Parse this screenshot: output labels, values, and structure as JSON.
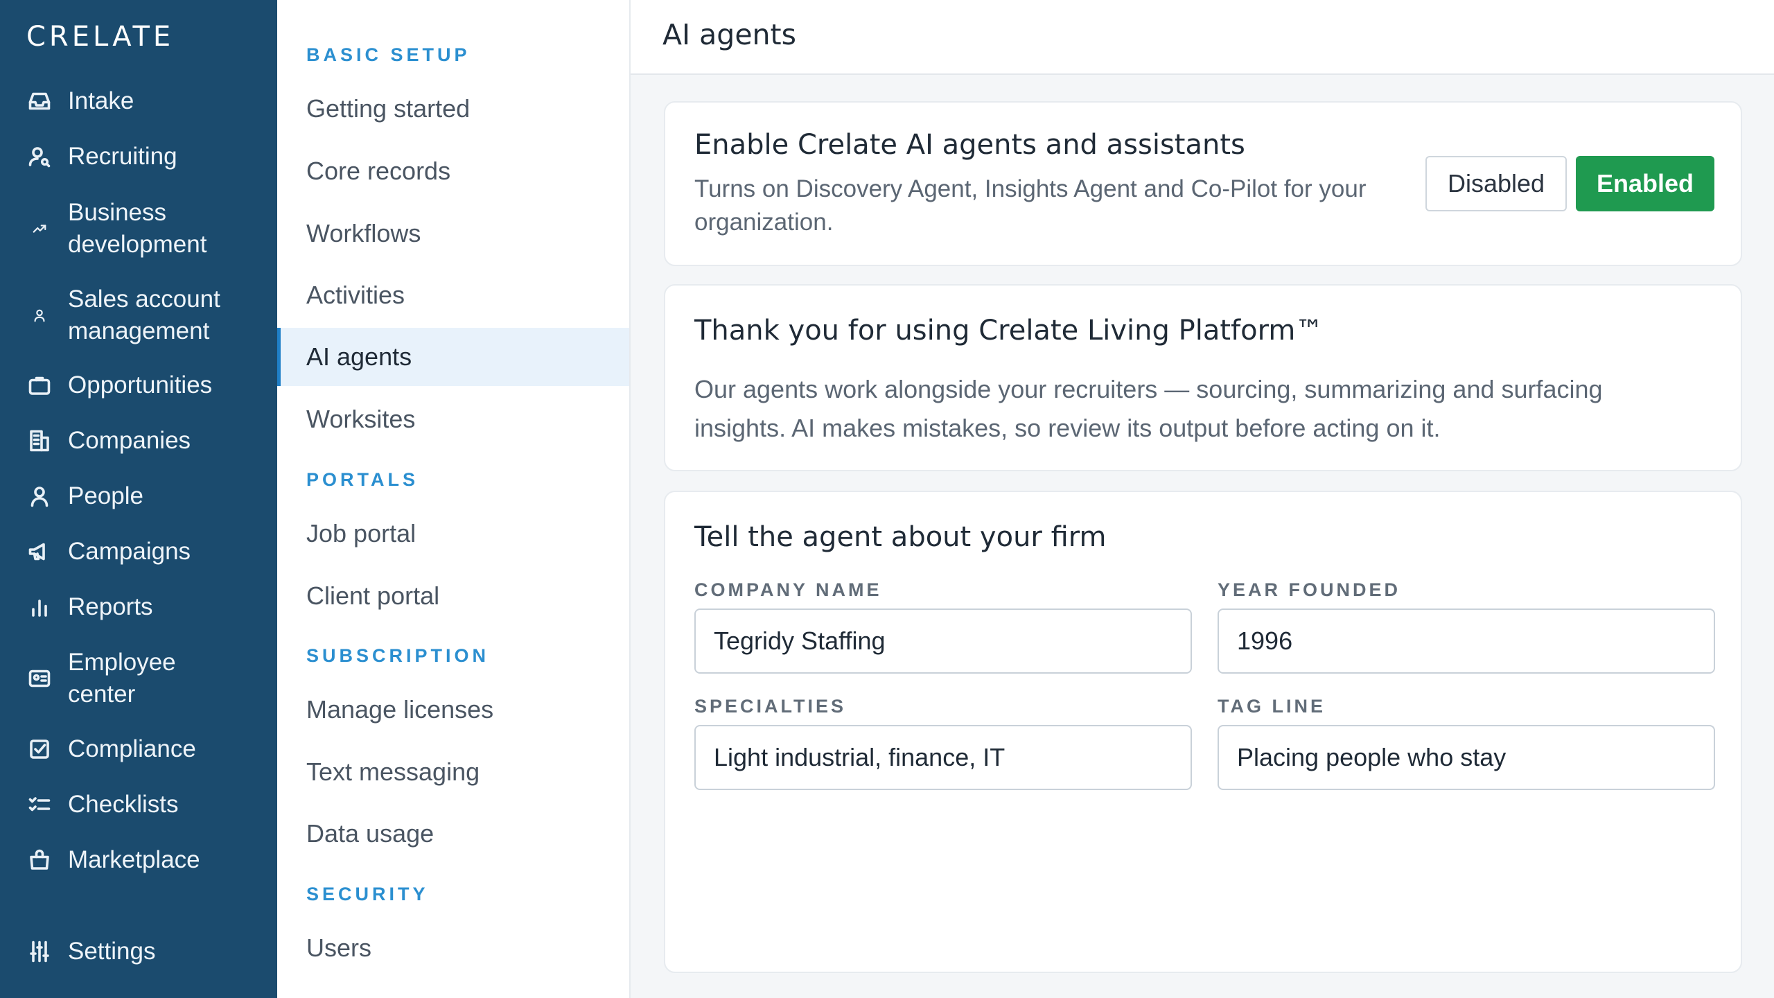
{
  "brand": "CRELATE",
  "nav": {
    "items": [
      {
        "label": "Intake",
        "icon": "inbox-icon"
      },
      {
        "label": "Recruiting",
        "icon": "user-search-icon"
      },
      {
        "label": "Business development",
        "icon": "trending-up-icon"
      },
      {
        "label": "Sales account management",
        "icon": "small-user-icon"
      },
      {
        "label": "Opportunities",
        "icon": "briefcase-icon"
      },
      {
        "label": "Companies",
        "icon": "building-icon"
      },
      {
        "label": "People",
        "icon": "person-icon"
      },
      {
        "label": "Campaigns",
        "icon": "megaphone-icon"
      },
      {
        "label": "Reports",
        "icon": "bar-chart-icon"
      },
      {
        "label": "Employee center",
        "icon": "id-card-icon"
      },
      {
        "label": "Compliance",
        "icon": "check-square-icon"
      },
      {
        "label": "Checklists",
        "icon": "list-check-icon"
      },
      {
        "label": "Marketplace",
        "icon": "shopping-bag-icon"
      }
    ],
    "settings": {
      "label": "Settings",
      "icon": "sliders-icon"
    }
  },
  "submenu": {
    "sections": [
      {
        "heading": "BASIC SETUP",
        "items": [
          "Getting started",
          "Core records",
          "Workflows",
          "Activities",
          "AI agents",
          "Worksites"
        ]
      },
      {
        "heading": "PORTALS",
        "items": [
          "Job portal",
          "Client portal"
        ]
      },
      {
        "heading": "SUBSCRIPTION",
        "items": [
          "Manage licenses",
          "Text messaging",
          "Data usage"
        ]
      },
      {
        "heading": "SECURITY",
        "items": [
          "Users"
        ]
      }
    ],
    "active": "AI agents"
  },
  "page": {
    "title": "AI agents"
  },
  "enable_card": {
    "title": "Enable Crelate AI agents and assistants",
    "description_line1": "Turns on Discovery Agent, Insights Agent and Co-Pilot for your",
    "description_line2": "organization.",
    "disabled_label": "Disabled",
    "enabled_label": "Enabled",
    "state": "Enabled"
  },
  "thanks_card": {
    "title": "Thank you for using Crelate Living Platform™",
    "body_line1": "Our agents work alongside your recruiters — sourcing, summarizing and surfacing",
    "body_line2": "insights. AI makes mistakes, so review its output before acting on it."
  },
  "firm_card": {
    "title": "Tell the agent about your firm",
    "company_name_label": "COMPANY NAME",
    "company_name_value": "Tegridy Staffing",
    "year_founded_label": "YEAR FOUNDED",
    "year_founded_value": "1996",
    "specialties_label": "SPECIALTIES",
    "specialties_value": "Light industrial, finance, IT",
    "tagline_label": "TAG LINE",
    "tagline_value": "Placing people who stay"
  },
  "colors": {
    "nav_bg": "#1b4b6e",
    "accent": "#2b8fd0",
    "enabled_green": "#1f9a50"
  }
}
